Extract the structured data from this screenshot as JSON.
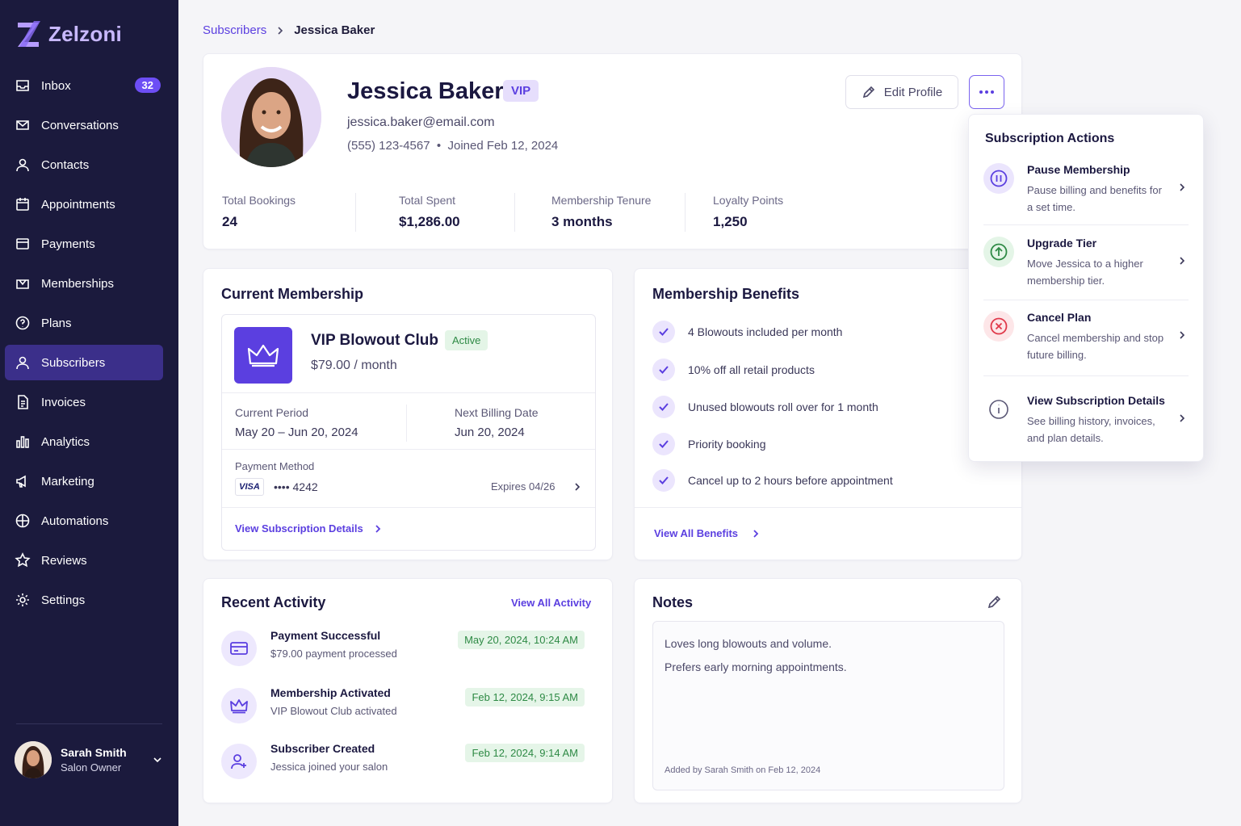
{
  "app": {
    "name": "Zelzoni"
  },
  "sidebar": {
    "items": [
      {
        "label": "Inbox",
        "icon": "inbox-icon",
        "badge": "32"
      },
      {
        "label": "Conversations",
        "icon": "conversations-icon"
      },
      {
        "label": "Contacts",
        "icon": "contacts-icon"
      },
      {
        "label": "Appointments",
        "icon": "calendar-icon"
      },
      {
        "label": "Payments",
        "icon": "payments-icon"
      },
      {
        "label": "Memberships",
        "icon": "memberships-icon"
      },
      {
        "label": "Plans",
        "icon": "plans-icon"
      },
      {
        "label": "Subscribers",
        "icon": "subscribers-icon",
        "active": true
      },
      {
        "label": "Invoices",
        "icon": "invoices-icon"
      },
      {
        "label": "Analytics",
        "icon": "analytics-icon"
      },
      {
        "label": "Marketing",
        "icon": "marketing-icon"
      },
      {
        "label": "Automations",
        "icon": "automations-icon"
      },
      {
        "label": "Reviews",
        "icon": "star-icon"
      },
      {
        "label": "Settings",
        "icon": "gear-icon"
      }
    ],
    "user": {
      "name": "Sarah Smith",
      "role": "Salon Owner"
    }
  },
  "breadcrumb": {
    "parent": "Subscribers",
    "current": "Jessica Baker"
  },
  "profile": {
    "name": "Jessica Baker",
    "badge": "VIP",
    "email": "jessica.baker@email.com",
    "meta": "(555) 123-4567  •  Joined Feb 12, 2024",
    "edit_label": "Edit Profile",
    "stats": [
      {
        "label": "Total Bookings",
        "value": "24"
      },
      {
        "label": "Total Spent",
        "value": "$1,286.00"
      },
      {
        "label": "Membership Tenure",
        "value": "3 months"
      },
      {
        "label": "Loyalty Points",
        "value": "1,250"
      }
    ]
  },
  "membership": {
    "title": "Current Membership",
    "plan_name": "VIP Blowout Club",
    "status": "Active",
    "price": "$79.00 / month",
    "current_period_label": "Current Period",
    "current_period": "May 20 – Jun 20, 2024",
    "next_billing_label": "Next Billing Date",
    "next_billing": "Jun 20, 2024",
    "payment_label": "Payment Method",
    "card_brand": "VISA",
    "card_number": "•••• 4242",
    "expires": "Expires 04/26",
    "link": "View Subscription Details"
  },
  "benefits": {
    "title": "Membership Benefits",
    "items": [
      "4 Blowouts included per month",
      "10% off all retail products",
      "Unused blowouts roll over for 1 month",
      "Priority booking",
      "Cancel up to 2 hours before appointment"
    ],
    "link": "View All Benefits"
  },
  "activity": {
    "title": "Recent Activity",
    "link": "View All Activity",
    "items": [
      {
        "title": "Payment Successful",
        "sub": "$79.00 payment processed",
        "time": "May 20, 2024, 10:24 AM",
        "icon": "credit-card-icon"
      },
      {
        "title": "Membership Activated",
        "sub": "VIP Blowout Club activated",
        "time": "Feb 12, 2024, 9:15 AM",
        "icon": "crown-icon"
      },
      {
        "title": "Subscriber Created",
        "sub": "Jessica joined your salon",
        "time": "Feb 12, 2024, 9:14 AM",
        "icon": "user-plus-icon"
      }
    ]
  },
  "notes": {
    "title": "Notes",
    "lines": [
      "Loves long blowouts and volume.",
      "Prefers early morning appointments."
    ],
    "footer": "Added by Sarah Smith on Feb 12, 2024"
  },
  "dropdown": {
    "title": "Subscription Actions",
    "items": [
      {
        "name": "Pause Membership",
        "desc": "Pause billing and benefits for a set time.",
        "icon": "pause-icon",
        "color": "#5b3fe0"
      },
      {
        "name": "Upgrade Tier",
        "desc": "Move Jessica to a higher membership tier.",
        "icon": "arrow-up-icon",
        "color": "#2e8a45"
      },
      {
        "name": "Cancel Plan",
        "desc": "Cancel membership and stop future billing.",
        "icon": "x-circle-icon",
        "color": "#e0394a"
      },
      {
        "name": "View Subscription Details",
        "desc": "See billing history, invoices, and plan details.",
        "icon": "info-icon",
        "color": "#5a5775"
      }
    ]
  },
  "colors": {
    "sidebar_bg": "#1b1a3d",
    "accent": "#5b3fe0",
    "active_nav": "#3b2f8a",
    "success": "#2e8a45",
    "danger": "#e0394a"
  }
}
